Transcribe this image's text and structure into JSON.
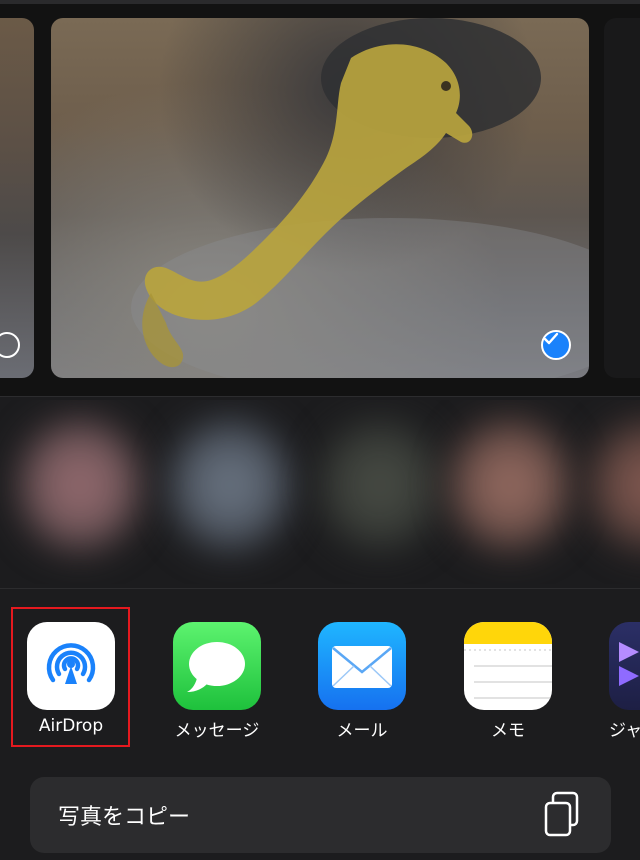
{
  "photos": {
    "previous": {
      "selected": false
    },
    "current": {
      "selected": true
    }
  },
  "apps": [
    {
      "id": "airdrop",
      "label": "AirDrop",
      "icon": "airdrop-icon",
      "color": "#1a82fb"
    },
    {
      "id": "messages",
      "label": "メッセージ",
      "icon": "messages-icon",
      "color": "#34c759"
    },
    {
      "id": "mail",
      "label": "メール",
      "icon": "mail-icon",
      "color": "#1a8cff"
    },
    {
      "id": "notes",
      "label": "メモ",
      "icon": "notes-icon",
      "color": "#ffd60a"
    },
    {
      "id": "partial",
      "label": "ジャ",
      "icon": "shortcuts-icon",
      "color": "#5e4ad6"
    }
  ],
  "actions": {
    "copy_photo": {
      "label": "写真をコピー",
      "icon": "copy-icon"
    }
  },
  "colors": {
    "highlight": "#e5191f",
    "selection": "#1a82fb",
    "background": "#1c1c1e"
  }
}
